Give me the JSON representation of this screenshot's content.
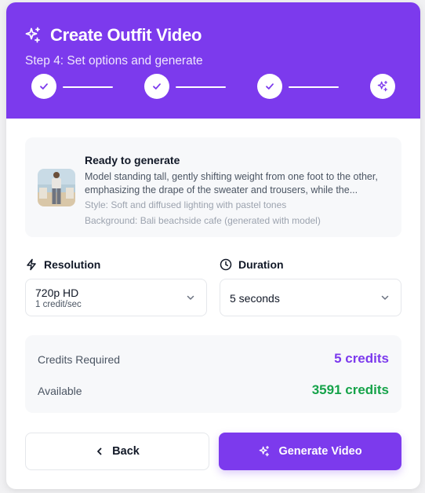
{
  "header": {
    "title": "Create Outfit Video",
    "subtitle": "Step 4: Set options and generate",
    "steps": [
      {
        "state": "completed",
        "icon": "check-icon"
      },
      {
        "state": "completed",
        "icon": "check-icon"
      },
      {
        "state": "completed",
        "icon": "check-icon"
      },
      {
        "state": "current",
        "icon": "sparkles-icon"
      }
    ]
  },
  "summary": {
    "title": "Ready to generate",
    "description": "Model standing tall, gently shifting weight from one foot to the other, emphasizing the drape of the sweater and trousers, while the...",
    "style": "Style: Soft and diffused lighting with pastel tones",
    "background": "Background: Bali beachside cafe (generated with model)"
  },
  "resolution": {
    "label": "Resolution",
    "value": "720p HD",
    "sub": "1 credit/sec",
    "icon": "lightning-icon"
  },
  "duration": {
    "label": "Duration",
    "value": "5 seconds",
    "icon": "clock-icon"
  },
  "credits": {
    "required_label": "Credits Required",
    "required_value": "5 credits",
    "available_label": "Available",
    "available_value": "3591 credits"
  },
  "buttons": {
    "back": "Back",
    "generate": "Generate Video"
  },
  "colors": {
    "primary": "#7c3aed",
    "available_green": "#16a34a"
  }
}
